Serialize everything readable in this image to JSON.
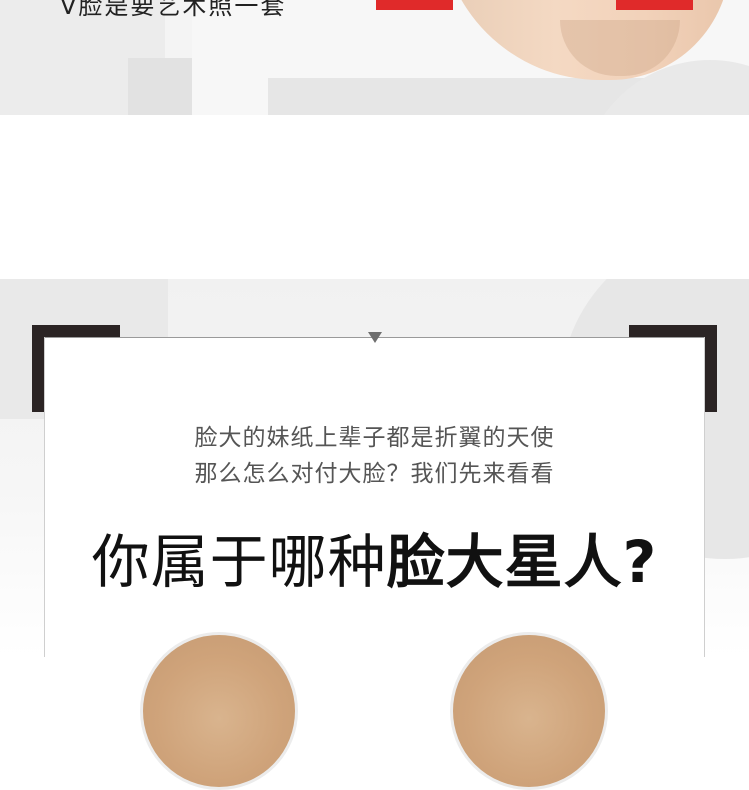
{
  "banner": {
    "title": "V脸是要艺术照一套"
  },
  "section": {
    "line1": "脸大的妹纸上辈子都是折翼的天使",
    "line2": "那么怎么对付大脸？我们先来看看",
    "headline_light": "你属于哪种",
    "headline_bold": "脸大星人?"
  },
  "colors": {
    "accent_red": "#e02a2a",
    "corner_dark": "#2b2424"
  }
}
